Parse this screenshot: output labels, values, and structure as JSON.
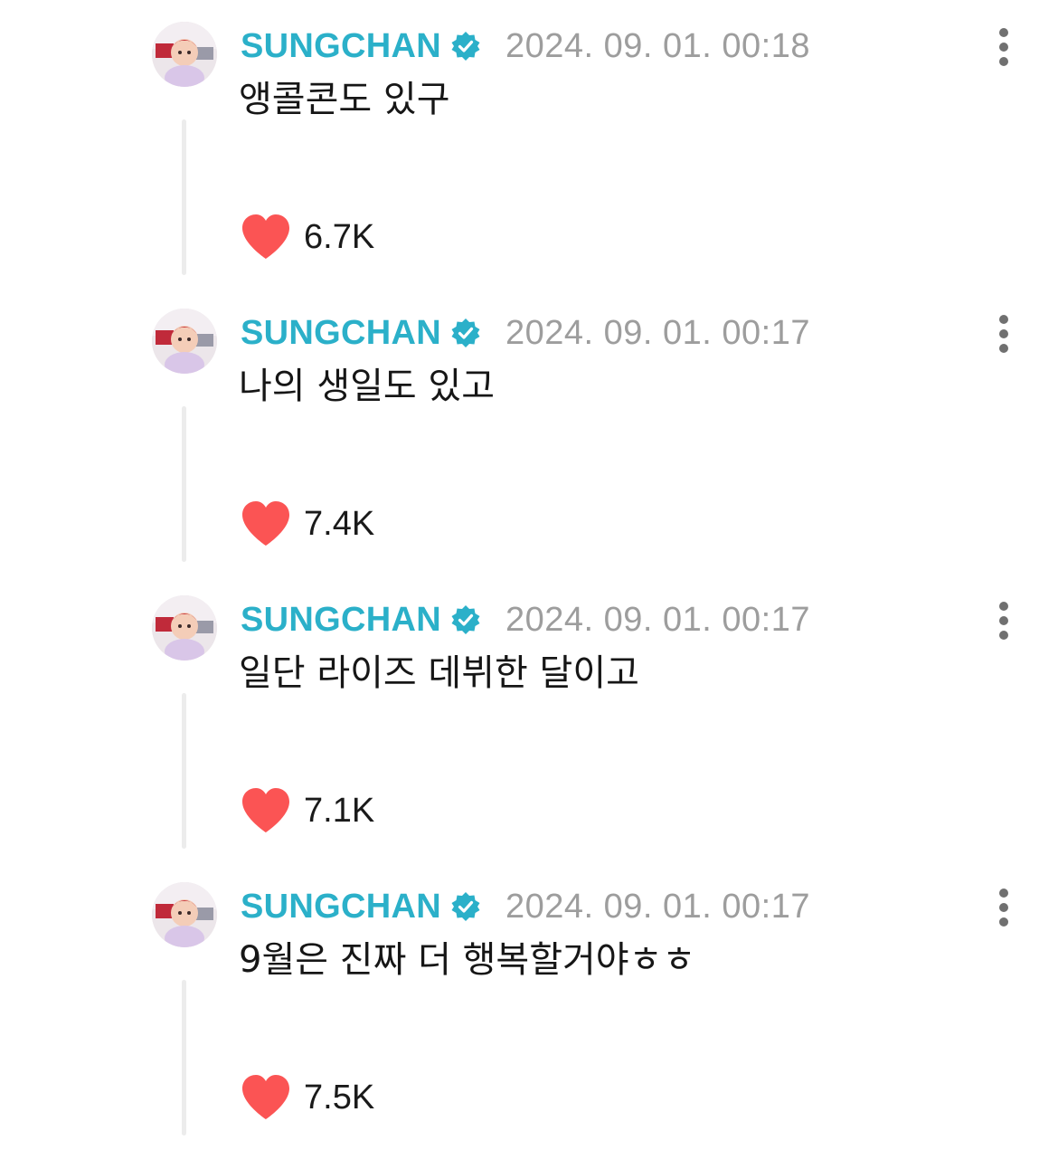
{
  "posts": [
    {
      "username": "SUNGCHAN",
      "timestamp": "2024. 09. 01. 00:18",
      "message": "앵콜콘도 있구",
      "likes": "6.7K"
    },
    {
      "username": "SUNGCHAN",
      "timestamp": "2024. 09. 01. 00:17",
      "message": "나의 생일도 있고",
      "likes": "7.4K"
    },
    {
      "username": "SUNGCHAN",
      "timestamp": "2024. 09. 01. 00:17",
      "message": "일단 라이즈 데뷔한 달이고",
      "likes": "7.1K"
    },
    {
      "username": "SUNGCHAN",
      "timestamp": "2024. 09. 01. 00:17",
      "message": "9월은 진짜 더 행복할거야ㅎㅎ",
      "likes": "7.5K"
    }
  ],
  "colors": {
    "username": "#2bb0c9",
    "verified_badge": "#2bb0c9",
    "timestamp": "#9d9d9d",
    "heart": "#fb5454",
    "thread_line": "#ececec"
  },
  "icons": {
    "verified": "verified-badge-icon",
    "like": "heart-icon",
    "more": "more-vertical-icon"
  }
}
